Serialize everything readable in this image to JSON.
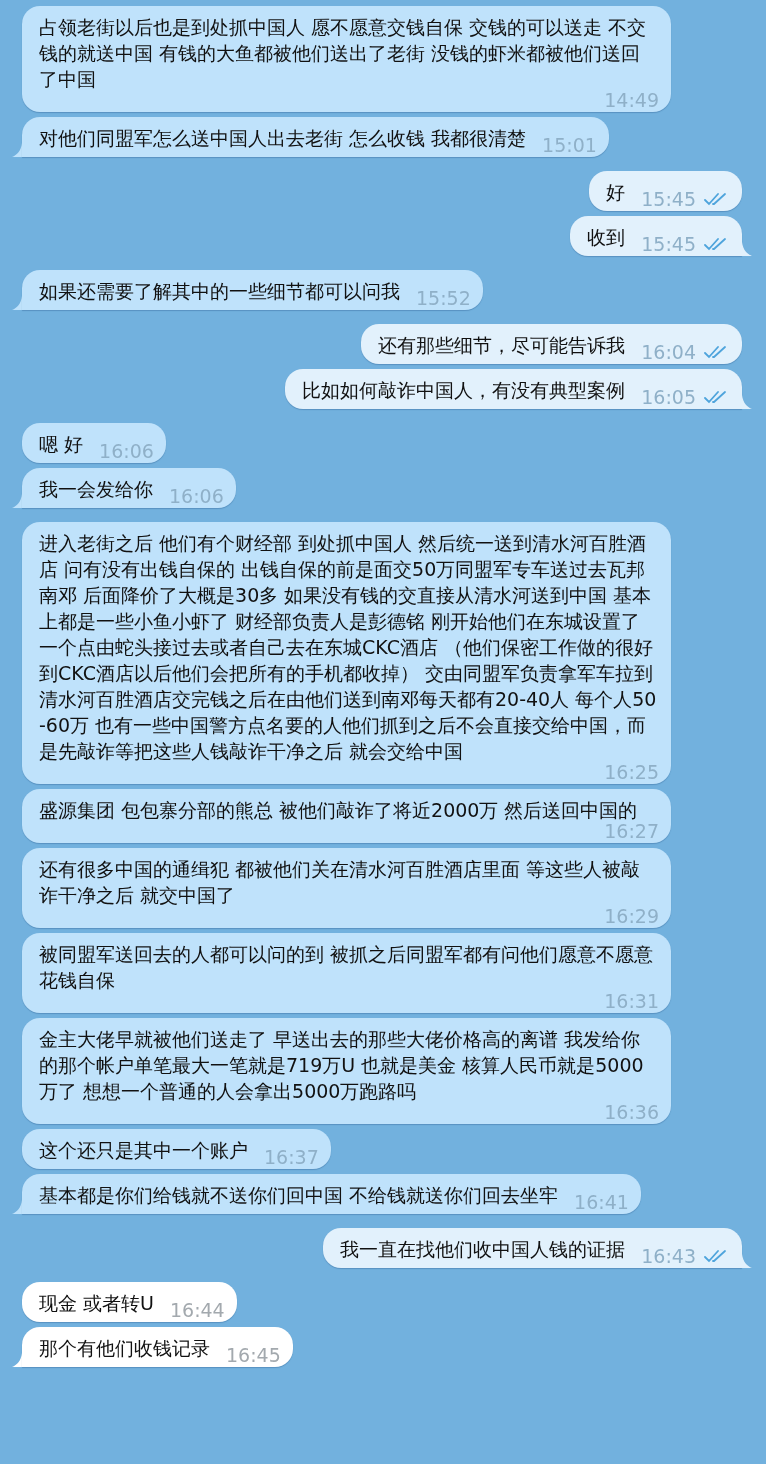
{
  "messages": [
    {
      "kind": "incoming",
      "selected": true,
      "tail": false,
      "text": "占领老街以后也是到处抓中国人 愿不愿意交钱自保 交钱的可以送走 不交钱的就送中国 有钱的大鱼都被他们送出了老街 没钱的虾米都被他们送回了中国",
      "time": "14:49"
    },
    {
      "kind": "incoming",
      "selected": true,
      "tail": true,
      "text": "对他们同盟军怎么送中国人出去老街 怎么收钱 我都很清楚",
      "time": "15:01"
    },
    {
      "kind": "outgoing",
      "selected": false,
      "tail": false,
      "read": true,
      "text": "好",
      "time": "15:45"
    },
    {
      "kind": "outgoing",
      "selected": false,
      "tail": true,
      "read": true,
      "text": "收到",
      "time": "15:45"
    },
    {
      "kind": "incoming",
      "selected": true,
      "tail": true,
      "text": "如果还需要了解其中的一些细节都可以问我",
      "time": "15:52"
    },
    {
      "kind": "outgoing",
      "selected": false,
      "tail": false,
      "read": true,
      "text": "还有那些细节，尽可能告诉我",
      "time": "16:04"
    },
    {
      "kind": "outgoing",
      "selected": false,
      "tail": true,
      "read": true,
      "text": "比如如何敲诈中国人，有没有典型案例",
      "time": "16:05"
    },
    {
      "kind": "incoming",
      "selected": true,
      "tail": false,
      "text": "嗯 好",
      "time": "16:06"
    },
    {
      "kind": "incoming",
      "selected": true,
      "tail": true,
      "text": "我一会发给你",
      "time": "16:06"
    },
    {
      "kind": "incoming",
      "selected": true,
      "tail": false,
      "text": "进入老街之后 他们有个财经部 到处抓中国人 然后统一送到清水河百胜酒店 问有没有出钱自保的 出钱自保的前是面交50万同盟军专车送过去瓦邦南邓 后面降价了大概是30多 如果没有钱的交直接从清水河送到中国 基本上都是一些小鱼小虾了 财经部负责人是彭德铭 刚开始他们在东城设置了一个点由蛇头接过去或者自己去在东城CKC酒店 （他们保密工作做的很好到CKC酒店以后他们会把所有的手机都收掉） 交由同盟军负责拿军车拉到清水河百胜酒店交完钱之后在由他们送到南邓每天都有20-40人 每个人50-60万 也有一些中国警方点名要的人他们抓到之后不会直接交给中国，而是先敲诈等把这些人钱敲诈干净之后 就会交给中国",
      "time": "16:25"
    },
    {
      "kind": "incoming",
      "selected": true,
      "tail": false,
      "text": "盛源集团 包包寨分部的熊总 被他们敲诈了将近2000万 然后送回中国的",
      "time": "16:27"
    },
    {
      "kind": "incoming",
      "selected": true,
      "tail": false,
      "text": "还有很多中国的通缉犯 都被他们关在清水河百胜酒店里面 等这些人被敲诈干净之后 就交中国了",
      "time": "16:29"
    },
    {
      "kind": "incoming",
      "selected": true,
      "tail": false,
      "text": "被同盟军送回去的人都可以问的到 被抓之后同盟军都有问他们愿意不愿意花钱自保",
      "time": "16:31"
    },
    {
      "kind": "incoming",
      "selected": true,
      "tail": false,
      "text": "金主大佬早就被他们送走了 早送出去的那些大佬价格高的离谱 我发给你的那个帐户单笔最大一笔就是719万U 也就是美金 核算人民币就是5000万了 想想一个普通的人会拿出5000万跑路吗",
      "time": "16:36"
    },
    {
      "kind": "incoming",
      "selected": true,
      "tail": false,
      "text": "这个还只是其中一个账户",
      "time": "16:37"
    },
    {
      "kind": "incoming",
      "selected": true,
      "tail": true,
      "text": "基本都是你们给钱就不送你们回中国 不给钱就送你们回去坐牢",
      "time": "16:41"
    },
    {
      "kind": "outgoing",
      "selected": false,
      "tail": true,
      "read": true,
      "text": "我一直在找他们收中国人钱的证据",
      "time": "16:43"
    },
    {
      "kind": "incoming",
      "selected": false,
      "tail": false,
      "text": "现金 或者转U",
      "time": "16:44"
    },
    {
      "kind": "incoming",
      "selected": false,
      "tail": true,
      "text": "那个有他们收钱记录",
      "time": "16:45"
    }
  ]
}
